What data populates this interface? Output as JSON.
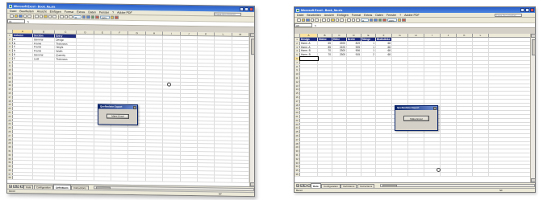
{
  "shot1": {
    "title": "Microsoft Excel - Book_Na.xls",
    "menus": [
      "Datei",
      "Bearbeiten",
      "Ansicht",
      "Einfügen",
      "Format",
      "Extras",
      "Daten",
      "Fenster",
      "?",
      "Adobe PDF"
    ],
    "help_placeholder": "Frage hier eingeben",
    "font_size": "11",
    "zoom": "100%",
    "name_box": "A1",
    "columns": [
      "A",
      "B",
      "C",
      "D",
      "E",
      "F",
      "G",
      "H",
      "I",
      "J",
      "K",
      "L",
      "M"
    ],
    "headers": [
      "Column",
      "Section",
      "Entry"
    ],
    "data_rows": [
      [
        "A",
        "General",
        "Design"
      ],
      [
        "B",
        "Frame",
        "Thickness"
      ],
      [
        "C",
        "Frame",
        "Height"
      ],
      [
        "D",
        "Frame",
        "Width"
      ],
      [
        "E",
        "General",
        "Quantity"
      ],
      [
        "F",
        "Leaf",
        "Thickness"
      ]
    ],
    "row_count": 38,
    "sheet_tabs": [
      "Data",
      "Configuration",
      "Definitions",
      "Instructions"
    ],
    "active_tab": "Definitions",
    "status_left": "Bereit",
    "status_right": "NF",
    "dialog_title": "Quellenliste Export",
    "dialog_button": "Make Excel"
  },
  "shot2": {
    "title": "Microsoft Excel - Book_Na.xls",
    "menus": [
      "Datei",
      "Bearbeiten",
      "Ansicht",
      "Einfügen",
      "Format",
      "Extras",
      "Daten",
      "Fenster",
      "?",
      "Adobe PDF"
    ],
    "help_placeholder": "Frage hier eingeben",
    "font_size": "11",
    "zoom": "100%",
    "name_box": "A6",
    "columns": [
      "A",
      "B",
      "C",
      "D",
      "E",
      "F",
      "G",
      "H",
      "I",
      "J",
      "K",
      "L"
    ],
    "headers": [
      "Design",
      "Stärke",
      "Höhe",
      "Breite",
      "Menge",
      "Blattstärke"
    ],
    "data_rows": [
      [
        "Harm. A",
        "65",
        "2200",
        "819",
        "1",
        "68"
      ],
      [
        "Harm. A",
        "85",
        "2100",
        "925",
        "1",
        "68"
      ],
      [
        "Harm. B",
        "70",
        "2300",
        "906",
        "1",
        "68"
      ],
      [
        "Harm. B",
        "70",
        "2300",
        "915",
        "2",
        "68"
      ]
    ],
    "row_count": 36,
    "sheet_tabs": [
      "Data",
      "Configuration",
      "Definitions",
      "Instructions"
    ],
    "active_tab": "Data",
    "status_left": "Bereit",
    "status_right": "NF",
    "dialog_title": "Quellenliste Export",
    "dialog_button": "Make Excel"
  }
}
